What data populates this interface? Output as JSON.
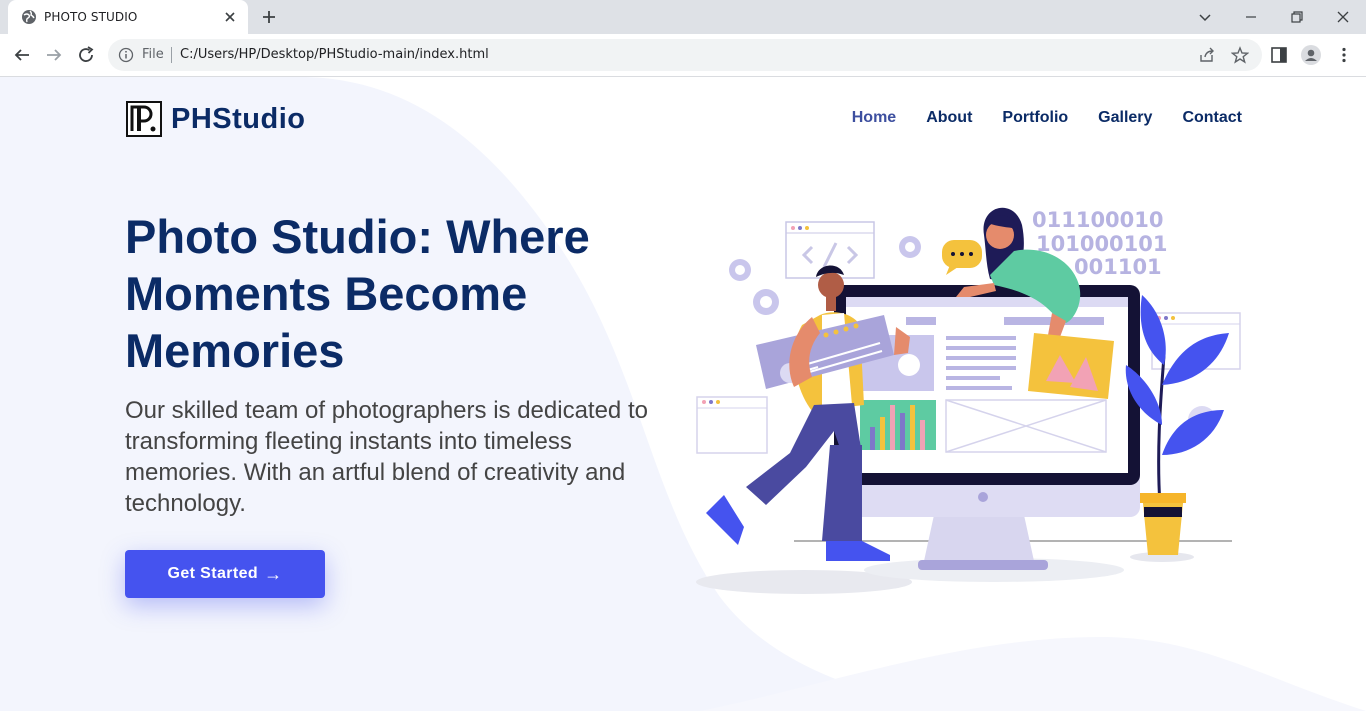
{
  "browser": {
    "tab_title": "PHOTO STUDIO",
    "file_label": "File",
    "url": "C:/Users/HP/Desktop/PHStudio-main/index.html"
  },
  "site": {
    "logo_text": "PHStudio",
    "nav": [
      "Home",
      "About",
      "Portfolio",
      "Gallery",
      "Contact"
    ],
    "active_nav": "Home"
  },
  "hero": {
    "title": "Photo Studio: Where Moments Become Memories",
    "description": "Our skilled team of photographers is dedicated to transforming fleeting instants into timeless memories. With an artful blend of creativity and technology.",
    "cta_label": "Get Started",
    "cta_arrow": "→"
  },
  "illustration": {
    "binary_lines": [
      "011100010",
      "101000101",
      "001101"
    ]
  },
  "colors": {
    "brand_navy": "#0b2b66",
    "cta_blue": "#4553ef",
    "hero_bg": "#f3f5fd"
  }
}
